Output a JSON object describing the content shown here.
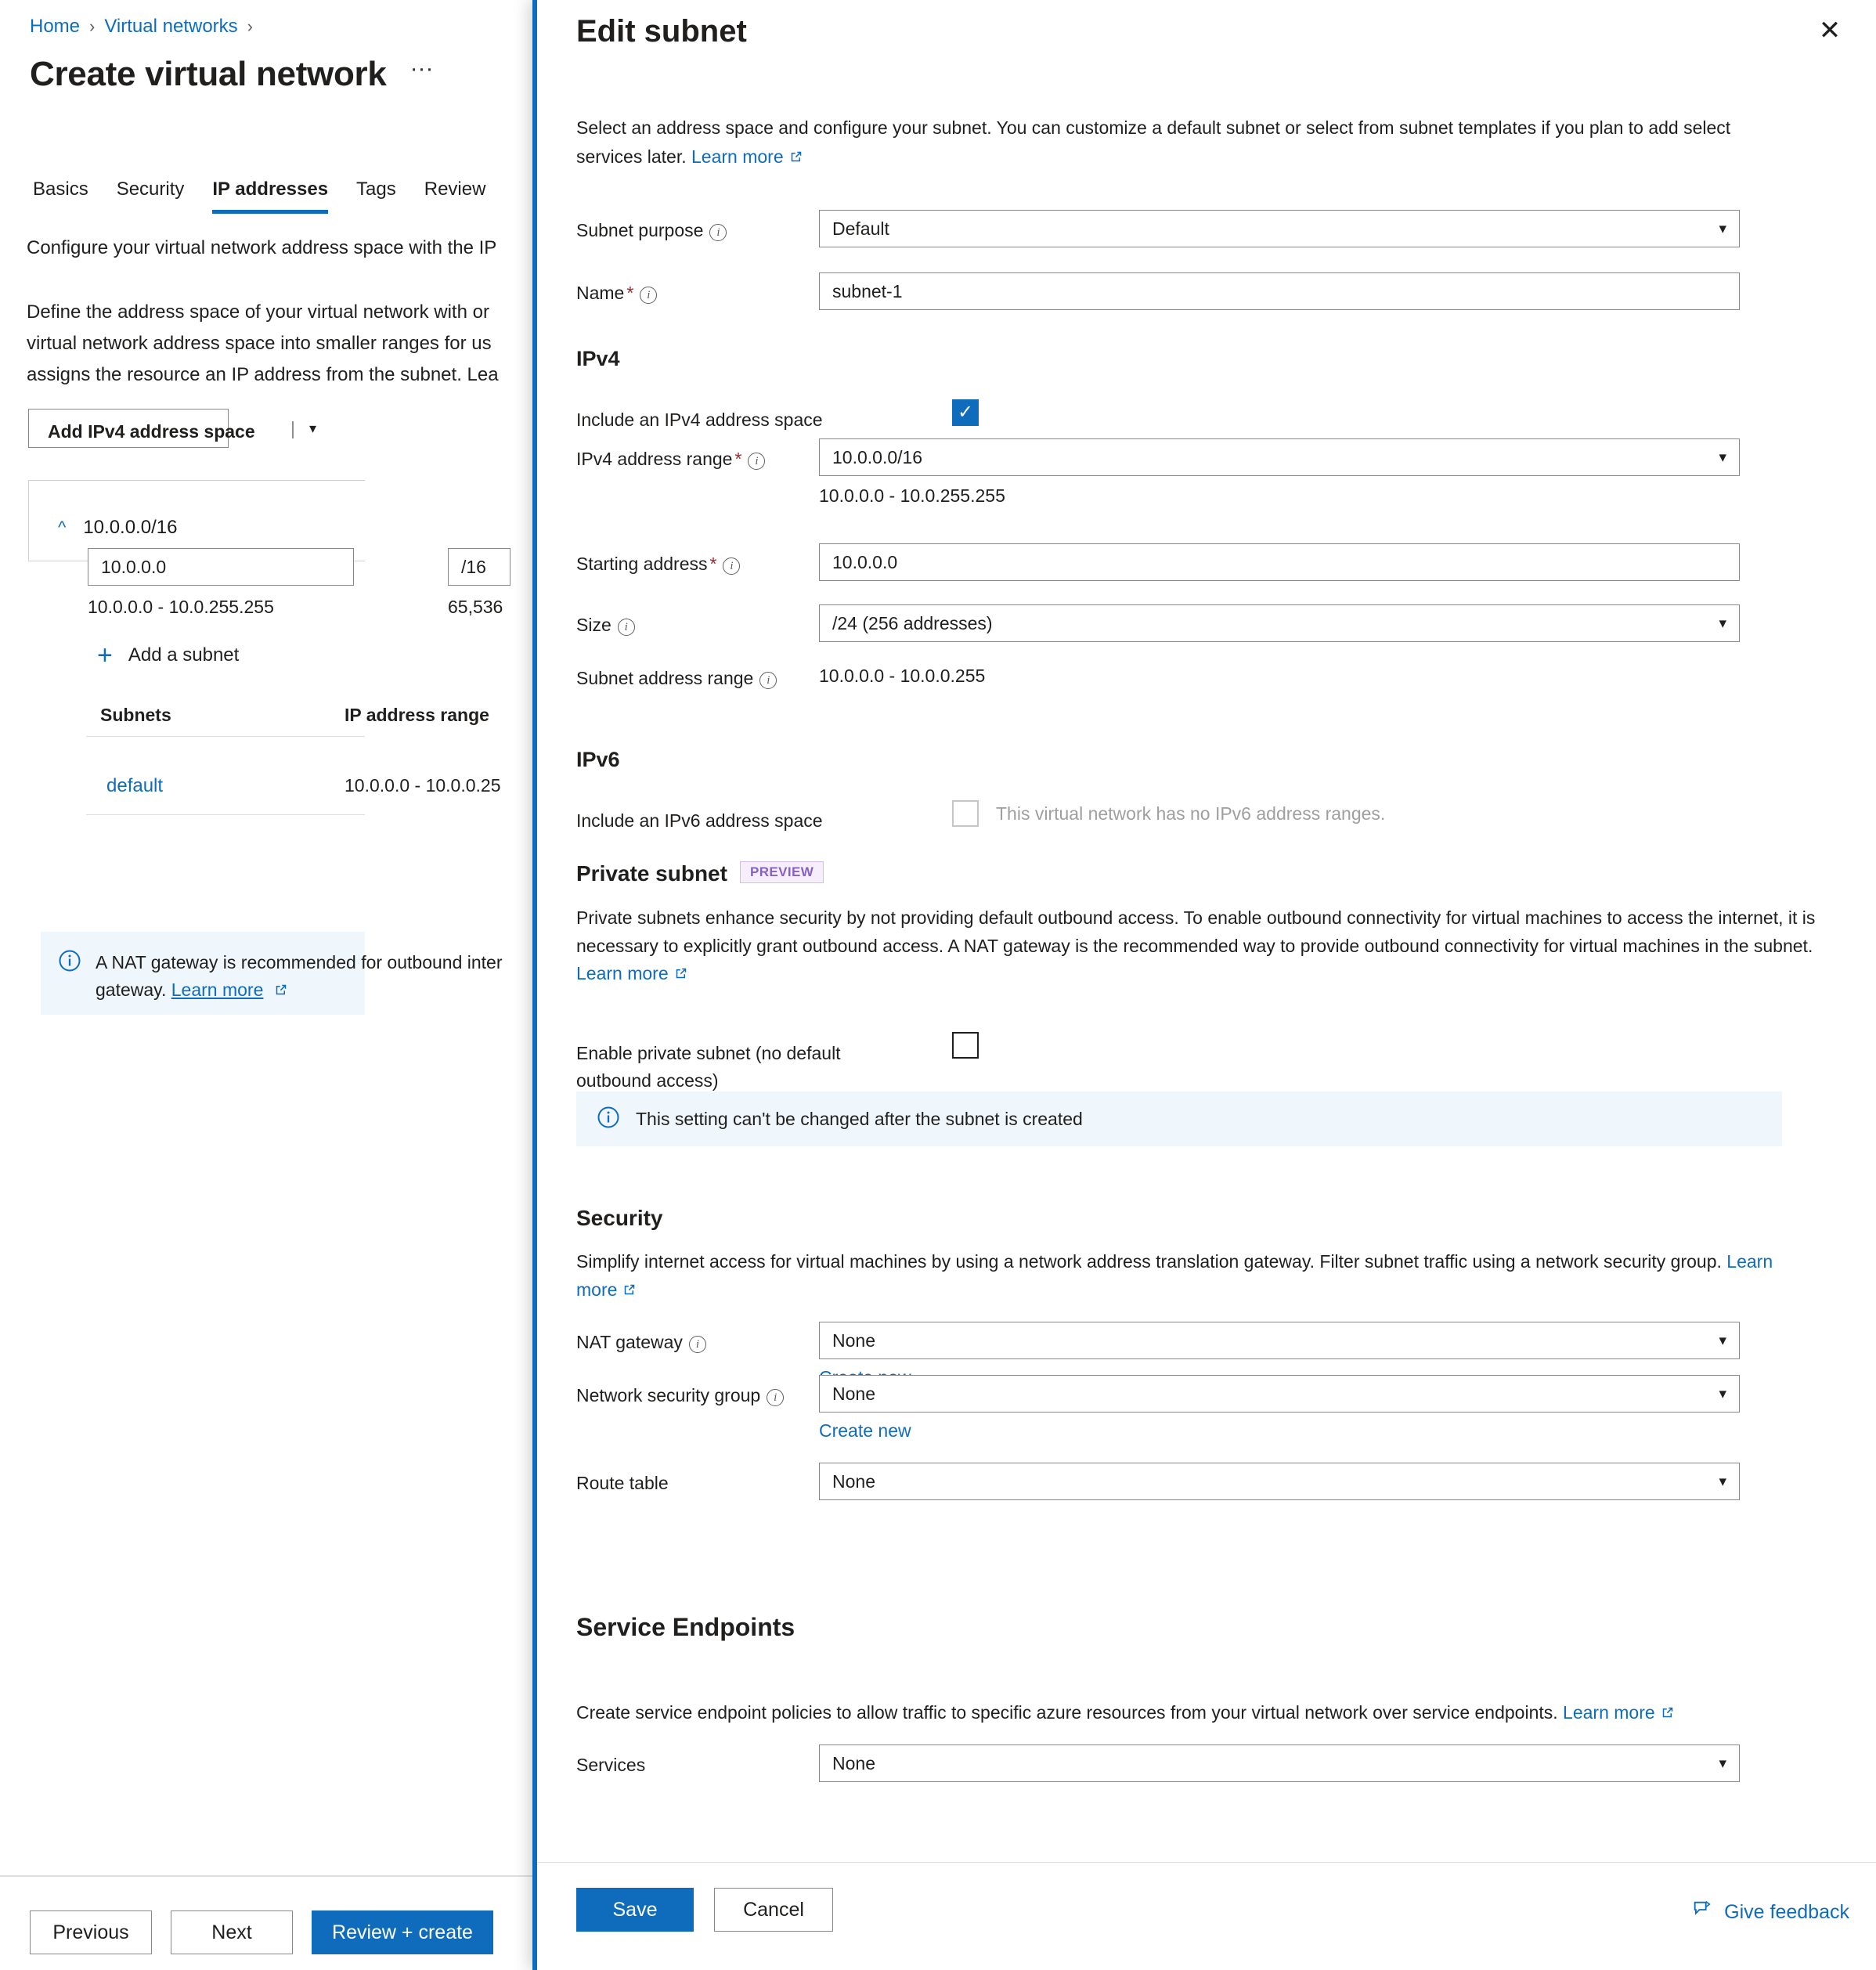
{
  "left_blade": {
    "breadcrumb": {
      "home": "Home",
      "section": "Virtual networks"
    },
    "title": "Create virtual network",
    "overflow_label": "···",
    "tabs": [
      {
        "label": "Basics",
        "active": false
      },
      {
        "label": "Security",
        "active": false
      },
      {
        "label": "IP addresses",
        "active": true
      },
      {
        "label": "Tags",
        "active": false
      },
      {
        "label": "Review",
        "active": false
      }
    ],
    "intro_line": "Configure your virtual network address space with the IP",
    "body_line_1": "Define the address space of your virtual network with or",
    "body_line_2": "virtual network address space into smaller ranges for us",
    "body_line_3": "assigns the resource an IP address from the subnet. Lea",
    "add_ipv4_button": "Add IPv4 address space",
    "address_space": {
      "cidr": "10.0.0.0/16",
      "address_value": "10.0.0.0",
      "mask_value": "/16",
      "range_text": "10.0.0.0 - 10.0.255.255",
      "count_text": "65,536",
      "add_subnet_label": "Add a subnet"
    },
    "subnets_table": {
      "col_name": "Subnets",
      "col_range": "IP address range",
      "rows": [
        {
          "name": "default",
          "range": "10.0.0.0 - 10.0.0.25"
        }
      ]
    },
    "nat_info": {
      "line1": "A NAT gateway is recommended for outbound inter",
      "line2_prefix": "gateway.",
      "learn_more": "Learn more"
    },
    "footer_buttons": {
      "previous": "Previous",
      "next": "Next",
      "review_create": "Review + create"
    }
  },
  "flyout": {
    "title": "Edit subnet",
    "close_label": "✕",
    "description": "Select an address space and configure your subnet. You can customize a default subnet or select from subnet templates if you plan to add select services later.",
    "learn_more": "Learn more",
    "fields": {
      "subnet_purpose": {
        "label": "Subnet purpose",
        "value": "Default"
      },
      "name": {
        "label": "Name",
        "value": "subnet-1"
      }
    },
    "ipv4": {
      "heading": "IPv4",
      "include_label": "Include an IPv4 address space",
      "include_checked": true,
      "range_label": "IPv4 address range",
      "range_value": "10.0.0.0/16",
      "range_hint": "10.0.0.0 - 10.0.255.255",
      "starting_label": "Starting address",
      "starting_value": "10.0.0.0",
      "size_label": "Size",
      "size_value": "/24 (256 addresses)",
      "subnet_range_label": "Subnet address range",
      "subnet_range_value": "10.0.0.0 - 10.0.0.255"
    },
    "ipv6": {
      "heading": "IPv6",
      "include_label": "Include an IPv6 address space",
      "disabled_text": "This virtual network has no IPv6 address ranges.",
      "include_checked": false
    },
    "private_subnet": {
      "heading": "Private subnet",
      "badge": "PREVIEW",
      "description": "Private subnets enhance security by not providing default outbound access. To enable outbound connectivity for virtual machines to access the internet, it is necessary to explicitly grant outbound access. A NAT gateway is the recommended way to provide outbound connectivity for virtual machines in the subnet.",
      "learn_more": "Learn more",
      "enable_label_line1": "Enable private subnet (no default",
      "enable_label_line2": "outbound access)",
      "enable_checked": false,
      "info_text": "This setting can't be changed after the subnet is created"
    },
    "security": {
      "heading": "Security",
      "description": "Simplify internet access for virtual machines by using a network address translation gateway. Filter subnet traffic using a network security group.",
      "learn_more": "Learn more",
      "nat_gateway": {
        "label": "NAT gateway",
        "value": "None",
        "create_new": "Create new"
      },
      "network_security_group": {
        "label": "Network security group",
        "value": "None",
        "create_new": "Create new"
      },
      "route_table": {
        "label": "Route table",
        "value": "None"
      }
    },
    "service_endpoints": {
      "heading": "Service Endpoints",
      "description": "Create service endpoint policies to allow traffic to specific azure resources from your virtual network over service endpoints.",
      "learn_more": "Learn more",
      "services": {
        "label": "Services",
        "value": "None"
      }
    },
    "footer": {
      "save": "Save",
      "cancel": "Cancel",
      "give_feedback": "Give feedback"
    }
  },
  "colors": {
    "accent": "#0f6cbd",
    "link": "#0f6cbd",
    "info_bg": "#eff6fc",
    "preview_badge_fg": "#8661c5",
    "preview_badge_bg": "#f6eefb",
    "required_star": "#a4262c"
  }
}
